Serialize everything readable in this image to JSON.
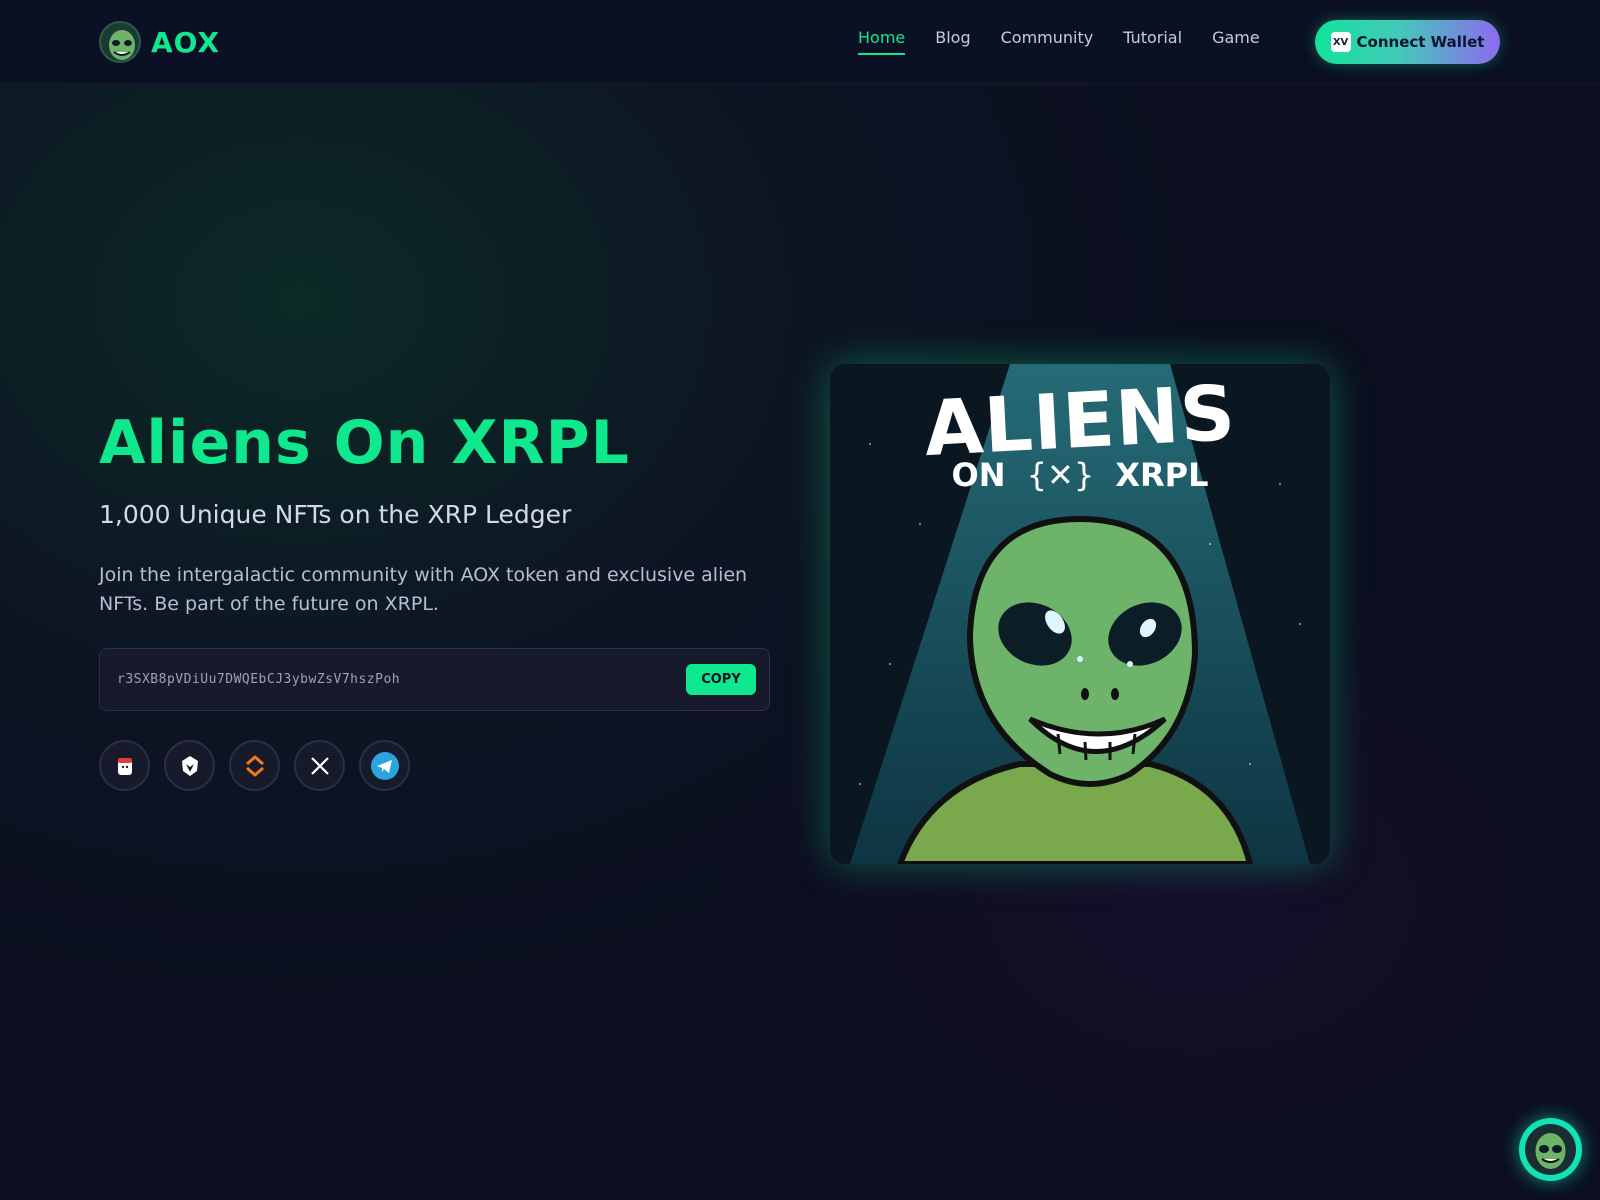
{
  "header": {
    "logo_text": "AOX",
    "nav": [
      {
        "label": "Home",
        "active": true
      },
      {
        "label": "Blog",
        "active": false
      },
      {
        "label": "Community",
        "active": false
      },
      {
        "label": "Tutorial",
        "active": false
      },
      {
        "label": "Game",
        "active": false
      }
    ],
    "wallet_button_label": "Connect Wallet",
    "wallet_icon_text": "XV"
  },
  "hero": {
    "title": "Aliens On XRPL",
    "subtitle": "1,000 Unique NFTs on the XRP Ledger",
    "description": "Join the intergalactic community with AOX token and exclusive alien NFTs. Be part of the future on XRPL.",
    "token_address": "r3SXB8pVDiUu7DWQEbCJ3ybwZsV7hszPoh",
    "copy_label": "COPY"
  },
  "socials": [
    {
      "icon": "firstledger-icon"
    },
    {
      "icon": "xpmarket-eagle-icon"
    },
    {
      "icon": "sologenic-icon"
    },
    {
      "icon": "x-twitter-icon"
    },
    {
      "icon": "telegram-icon"
    }
  ],
  "artwork": {
    "title": "ALIENS",
    "subtitle_left": "ON",
    "subtitle_right": "XRPL"
  },
  "colors": {
    "accent": "#10e88d",
    "background": "#0b1024",
    "wallet_gradient_start": "#12e39a",
    "wallet_gradient_end": "#8e6af0"
  }
}
